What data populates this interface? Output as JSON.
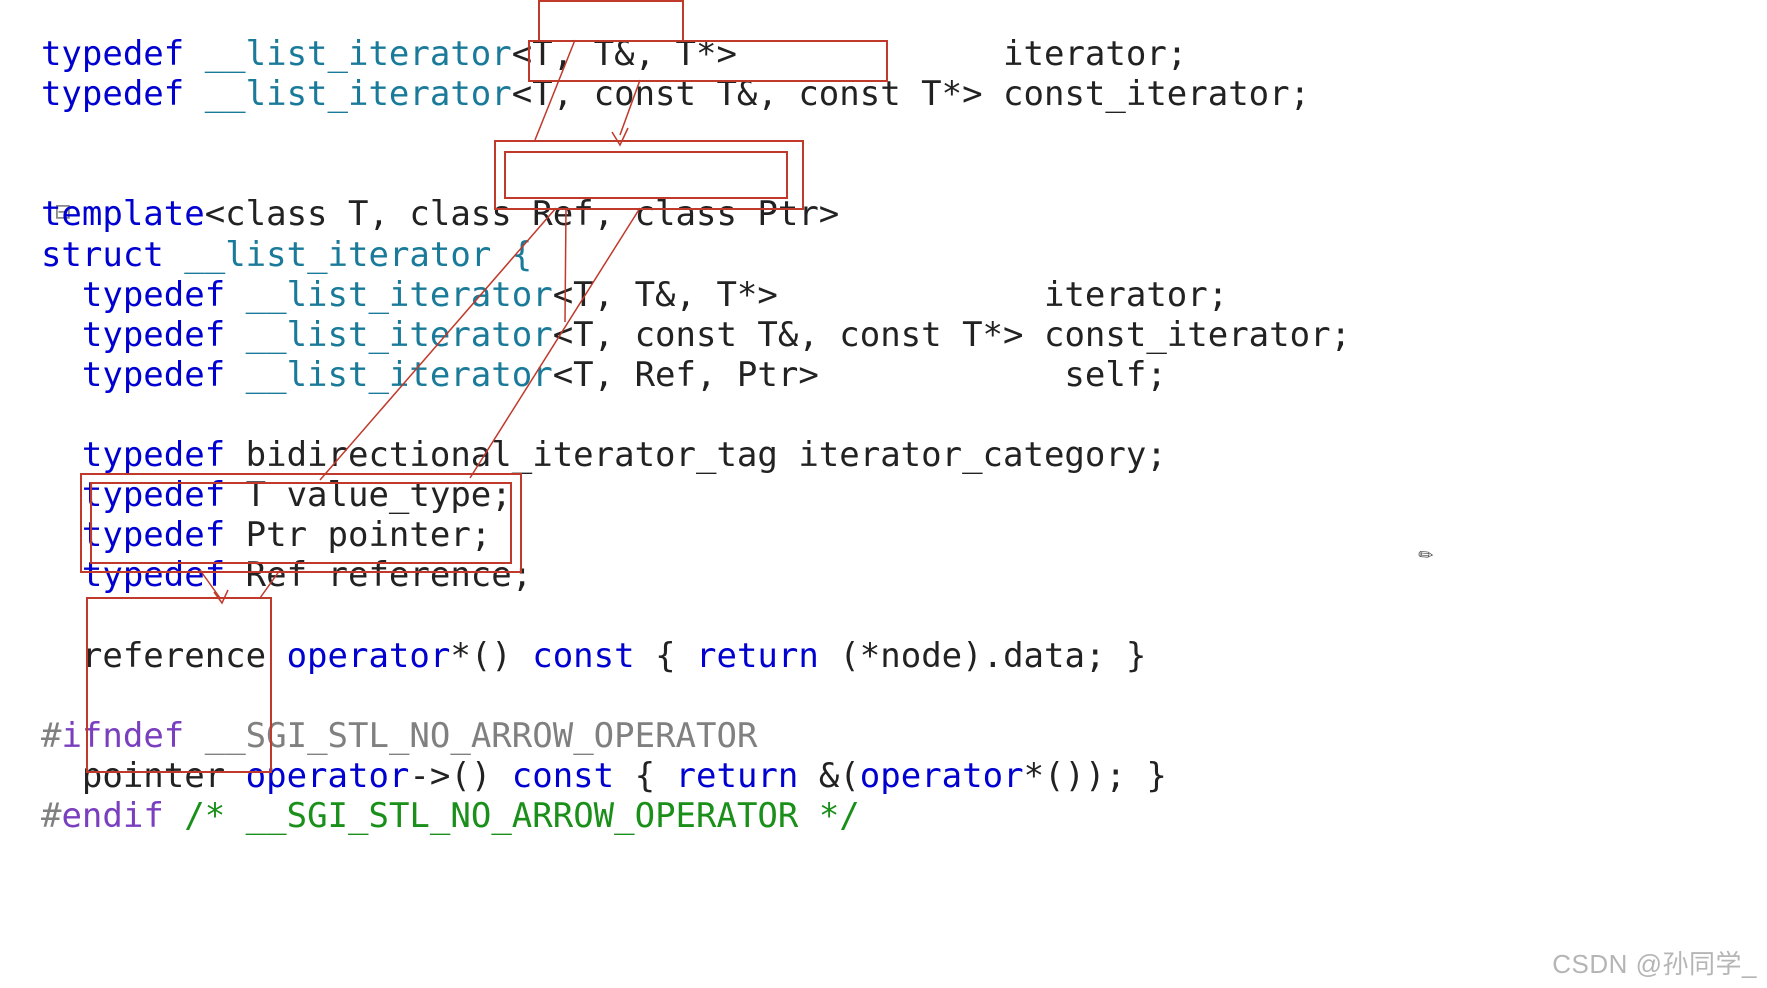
{
  "lines": {
    "l1a": "  typedef",
    "l1b": " __list_iterator",
    "l1c": "<T, T&, T*>",
    "l1d": "             iterator;",
    "l2a": "  typedef",
    "l2b": " __list_iterator",
    "l2c": "<T, const T&, const T*>",
    "l2d": " const_iterator;",
    "l3": "",
    "l4a": "  template",
    "l4b": "<class T, class Ref, class Ptr>",
    "l5a": "struct",
    "l5b": " __list_iterator {",
    "l6a": "    typedef",
    "l6b": " __list_iterator",
    "l6c": "<T, T&, T*>",
    "l6d": "             iterator;",
    "l7a": "    typedef",
    "l7b": " __list_iterator",
    "l7c": "<T, const T&, const T*>",
    "l7d": " const_iterator;",
    "l8a": "    typedef",
    "l8b": " __list_iterator",
    "l8c": "<T, Ref, Ptr>",
    "l8d": "            self;",
    "l9": "",
    "l10a": "    typedef",
    "l10b": " bidirectional_iterator_tag iterator_category;",
    "l11a": "    typedef",
    "l11b": " T value_type;",
    "l12a": "    typedef",
    "l12b": " Ptr pointer;",
    "l13a": "    typedef",
    "l13b": " Ref reference;",
    "l14": "",
    "l15a": "    reference ",
    "l15b": "operator",
    "l15c": "*() ",
    "l15d": "const",
    "l15e": " { ",
    "l15f": "return",
    "l15g": " (*node).data; }",
    "l16": "",
    "l17a": "#",
    "l17b": "ifndef",
    "l17c": " __SGI_STL_NO_ARROW_OPERATOR",
    "l18a": "    pointer ",
    "l18b": "operator",
    "l18c": "->() ",
    "l18d": "const",
    "l18e": " { ",
    "l18f": "return",
    "l18g": " &(",
    "l18h": "operator",
    "l18i": "*()); }",
    "l19a": "#",
    "l19b": "endif",
    "l19c": " /* __SGI_STL_NO_ARROW_OPERATOR */"
  },
  "watermark": "CSDN @孙同学_",
  "pencil": "✎",
  "fold": "⊟"
}
